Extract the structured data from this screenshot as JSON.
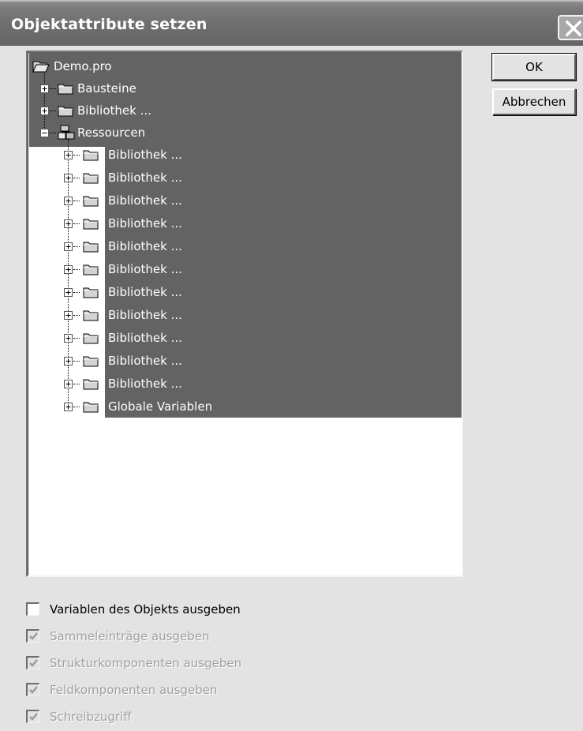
{
  "window": {
    "title": "Objektattribute setzen"
  },
  "buttons": {
    "ok_label": "OK",
    "cancel_label": "Abbrechen"
  },
  "tree": {
    "root": {
      "label": "Demo.pro",
      "icon": "open-folder-icon"
    },
    "level1": [
      {
        "label": "Bausteine",
        "icon": "folder-icon",
        "expander": "plus"
      },
      {
        "label": "Bibliothek ...",
        "icon": "folder-icon",
        "expander": "plus"
      },
      {
        "label": "Ressourcen",
        "icon": "resources-icon",
        "expander": "minus"
      }
    ],
    "ressourcen_children": [
      {
        "label": "Bibliothek ..."
      },
      {
        "label": "Bibliothek ..."
      },
      {
        "label": "Bibliothek ..."
      },
      {
        "label": "Bibliothek ..."
      },
      {
        "label": "Bibliothek ..."
      },
      {
        "label": "Bibliothek ..."
      },
      {
        "label": "Bibliothek ..."
      },
      {
        "label": "Bibliothek ..."
      },
      {
        "label": "Bibliothek ..."
      },
      {
        "label": "Bibliothek ..."
      },
      {
        "label": "Bibliothek ..."
      },
      {
        "label": "Globale Variablen"
      }
    ],
    "selection_color": "#636363"
  },
  "options": [
    {
      "label": "Variablen des Objekts ausgeben",
      "checked": false,
      "enabled": true
    },
    {
      "label": "Sammeleinträge ausgeben",
      "checked": true,
      "enabled": false
    },
    {
      "label": "Strukturkomponenten ausgeben",
      "checked": true,
      "enabled": false
    },
    {
      "label": "Feldkomponenten ausgeben",
      "checked": true,
      "enabled": false
    },
    {
      "label": "Schreibzugriff",
      "checked": true,
      "enabled": false
    }
  ]
}
